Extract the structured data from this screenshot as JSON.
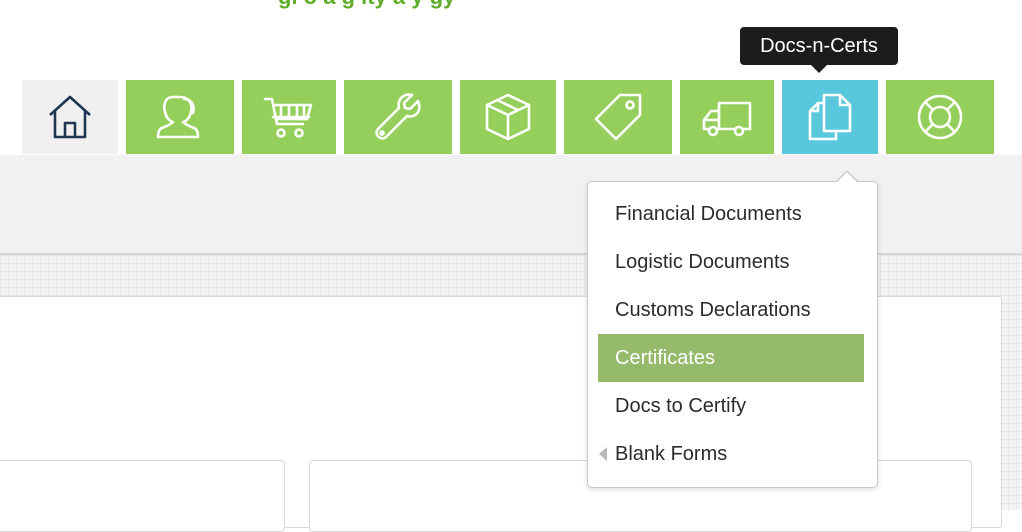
{
  "header": {
    "tagline": "gl o a  g  lty  a  y  gy"
  },
  "nav": {
    "items": [
      {
        "name": "home",
        "icon": "home-icon",
        "color": "#f0f0f0"
      },
      {
        "name": "contacts",
        "icon": "user-icon",
        "color": "#93cf5a"
      },
      {
        "name": "orders",
        "icon": "cart-icon",
        "color": "#93cf5a"
      },
      {
        "name": "tools",
        "icon": "wrench-icon",
        "color": "#93cf5a"
      },
      {
        "name": "products",
        "icon": "box-icon",
        "color": "#93cf5a"
      },
      {
        "name": "pricing",
        "icon": "tag-icon",
        "color": "#93cf5a"
      },
      {
        "name": "shipping",
        "icon": "truck-icon",
        "color": "#93cf5a"
      },
      {
        "name": "docs-n-certs",
        "icon": "documents-icon",
        "color": "#5ac8dc",
        "active": true
      },
      {
        "name": "support",
        "icon": "lifebuoy-icon",
        "color": "#93cf5a"
      }
    ],
    "tooltip": "Docs-n-Certs"
  },
  "dropdown": {
    "items": [
      {
        "label": "Financial Documents"
      },
      {
        "label": "Logistic Documents"
      },
      {
        "label": "Customs Declarations"
      },
      {
        "label": "Certificates",
        "selected": true
      },
      {
        "label": "Docs to Certify"
      },
      {
        "label": "Blank Forms",
        "has_submenu": true
      }
    ]
  },
  "colors": {
    "green_tile": "#93cf5a",
    "active_tile": "#5ac8dc",
    "selected_item": "#96ba6c",
    "brand_green": "#5fae2a"
  }
}
